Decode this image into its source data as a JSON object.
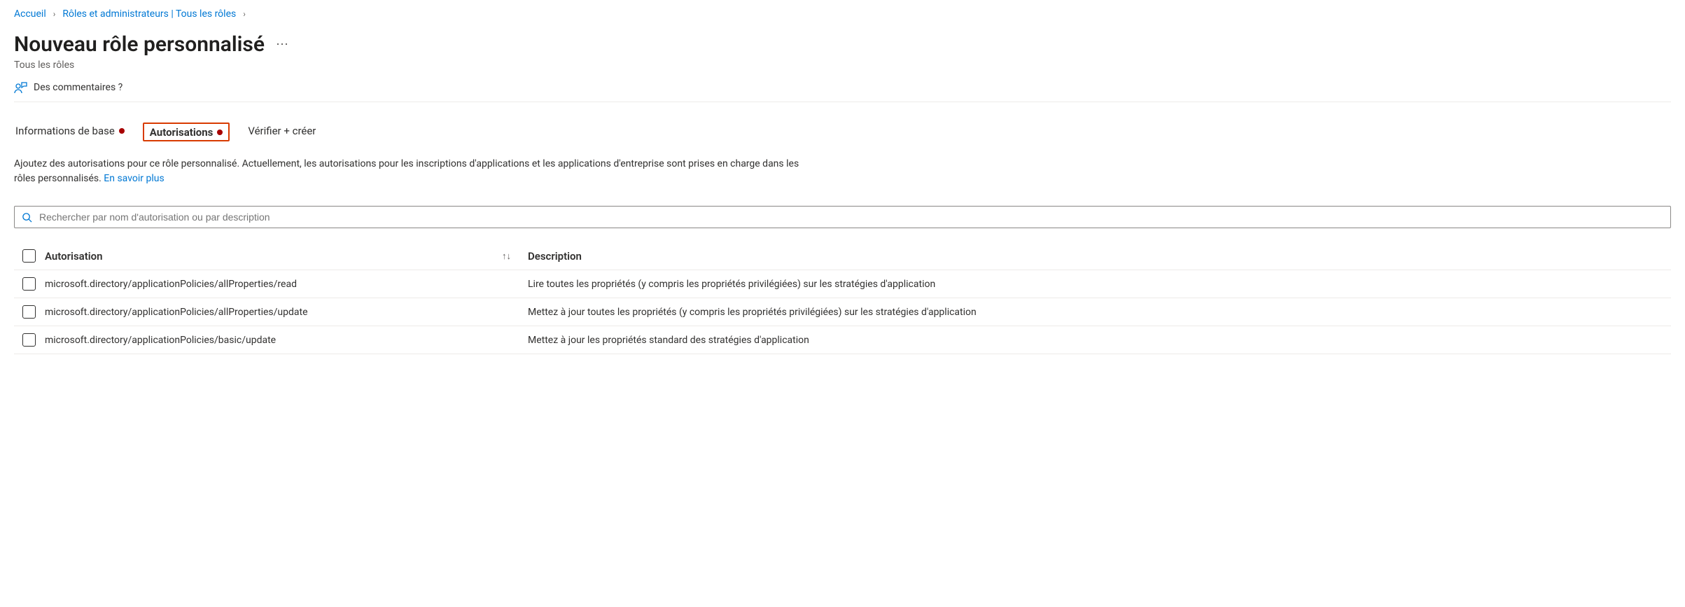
{
  "breadcrumb": {
    "home": "Accueil",
    "roles": "Rôles et administrateurs | Tous les rôles"
  },
  "header": {
    "title": "Nouveau rôle personnalisé",
    "subtitle": "Tous les rôles"
  },
  "toolbar": {
    "feedback_label": "Des commentaires ?"
  },
  "tabs": {
    "basics": "Informations de base",
    "permissions": "Autorisations",
    "review": "Vérifier + créer"
  },
  "description": {
    "text": "Ajoutez des autorisations pour ce rôle personnalisé. Actuellement, les autorisations pour les inscriptions d'applications et les applications d'entreprise sont prises en charge dans les rôles personnalisés. ",
    "link": "En savoir plus"
  },
  "search": {
    "placeholder": "Rechercher par nom d'autorisation ou par description"
  },
  "table": {
    "header_auth": "Autorisation",
    "header_desc": "Description",
    "rows": [
      {
        "auth": "microsoft.directory/applicationPolicies/allProperties/read",
        "desc": "Lire toutes les propriétés (y compris les propriétés privilégiées) sur les stratégies d'application"
      },
      {
        "auth": "microsoft.directory/applicationPolicies/allProperties/update",
        "desc": "Mettez à jour toutes les propriétés (y compris les propriétés privilégiées) sur les stratégies d'application"
      },
      {
        "auth": "microsoft.directory/applicationPolicies/basic/update",
        "desc": "Mettez à jour les propriétés standard des stratégies d'application"
      }
    ]
  }
}
